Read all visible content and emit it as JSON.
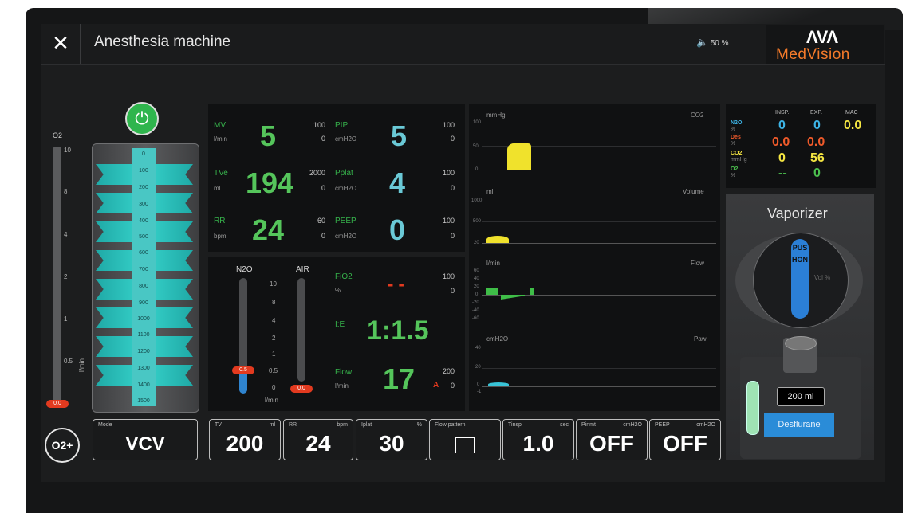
{
  "header": {
    "title": "Anesthesia machine",
    "volume": "50 %",
    "logo_mark": "ΛVΛ",
    "logo_text": "MedVision"
  },
  "o2_flow": {
    "label": "O2",
    "ticks": [
      "10",
      "8",
      "4",
      "2",
      "1",
      "0.5",
      "0"
    ],
    "unit": "l/min",
    "value": "0.0"
  },
  "bellows": {
    "scale": [
      "0",
      "100",
      "200",
      "300",
      "400",
      "500",
      "600",
      "700",
      "800",
      "900",
      "1000",
      "1100",
      "1200",
      "1300",
      "1400",
      "1500"
    ]
  },
  "monitor": {
    "mv": {
      "label": "MV",
      "unit": "l/min",
      "value": "5",
      "hi": "100",
      "lo": "0"
    },
    "tve": {
      "label": "TVe",
      "unit": "ml",
      "value": "194",
      "hi": "2000",
      "lo": "0"
    },
    "rr": {
      "label": "RR",
      "unit": "bpm",
      "value": "24",
      "hi": "60",
      "lo": "0"
    },
    "pip": {
      "label": "PIP",
      "unit": "cmH2O",
      "value": "5",
      "hi": "100",
      "lo": "0"
    },
    "pplat": {
      "label": "Pplat",
      "unit": "cmH2O",
      "value": "4",
      "hi": "100",
      "lo": "0"
    },
    "peep": {
      "label": "PEEP",
      "unit": "cmH2O",
      "value": "0",
      "hi": "100",
      "lo": "0"
    },
    "fio2": {
      "label": "FiO2",
      "unit": "%",
      "value": "- -",
      "hi": "100",
      "lo": "0"
    },
    "ie": {
      "label": "I:E",
      "value": "1:1.5"
    },
    "flow": {
      "label": "Flow",
      "unit": "l/min",
      "value": "17",
      "hi": "200",
      "lo": "0",
      "alarm": "A"
    }
  },
  "flowmeters": {
    "n2o_label": "N2O",
    "air_label": "AIR",
    "ticks": [
      "10",
      "8",
      "4",
      "2",
      "1",
      "0.5",
      "0"
    ],
    "unit": "l/min",
    "n2o_value": "0.5",
    "air_value": "0.0"
  },
  "waveforms": {
    "co2": {
      "title": "CO2",
      "unit": "mmHg",
      "ticks": [
        "100",
        "50",
        "0"
      ]
    },
    "volume": {
      "title": "Volume",
      "unit": "ml",
      "ticks": [
        "1000",
        "500",
        "20"
      ]
    },
    "flow": {
      "title": "Flow",
      "unit": "l/min",
      "ticks": [
        "60",
        "40",
        "20",
        "0",
        "-20",
        "-40",
        "-60"
      ]
    },
    "paw": {
      "title": "Paw",
      "unit": "cmH2O",
      "ticks": [
        "40",
        "20",
        "0",
        "-1"
      ]
    }
  },
  "gases": {
    "headers": {
      "insp": "INSP.",
      "exp": "EXP.",
      "mac": "MAC"
    },
    "n2o": {
      "label": "N2O",
      "unit": "%",
      "insp": "0",
      "exp": "0",
      "color": "#3db4e6"
    },
    "des": {
      "label": "Des",
      "unit": "%",
      "insp": "0.0",
      "exp": "0.0",
      "color": "#f05a2a"
    },
    "co2": {
      "label": "CO2",
      "unit": "mmHg",
      "insp": "0",
      "exp": "56",
      "color": "#f5e642"
    },
    "o2": {
      "label": "O2",
      "unit": "%",
      "insp": "--",
      "exp": "0",
      "color": "#4cc24f"
    },
    "mac": "0.0"
  },
  "vaporizer": {
    "title": "Vaporizer",
    "push_label": "PUSHON",
    "vol_label": "Vol %",
    "level": "200 ml",
    "agent": "Desflurane"
  },
  "settings": [
    {
      "name": "Mode",
      "unit": "",
      "value": "VCV"
    },
    {
      "name": "TV",
      "unit": "ml",
      "value": "200"
    },
    {
      "name": "RR",
      "unit": "bpm",
      "value": "24"
    },
    {
      "name": "Iplat",
      "unit": "%",
      "value": "30"
    },
    {
      "name": "Flow pattern",
      "unit": "",
      "value": ""
    },
    {
      "name": "Tinsp",
      "unit": "sec",
      "value": "1.0"
    },
    {
      "name": "Pinmt",
      "unit": "cmH2O",
      "value": "OFF"
    },
    {
      "name": "PEEP",
      "unit": "cmH2O",
      "value": "OFF"
    }
  ],
  "o2_flush": "O2+",
  "colors": {
    "green": "#55c55b",
    "cyan": "#6ac9d6",
    "red": "#e23a1f",
    "blue": "#2a8cd8",
    "yellow": "#f5e642",
    "orange": "#f47a2a"
  }
}
